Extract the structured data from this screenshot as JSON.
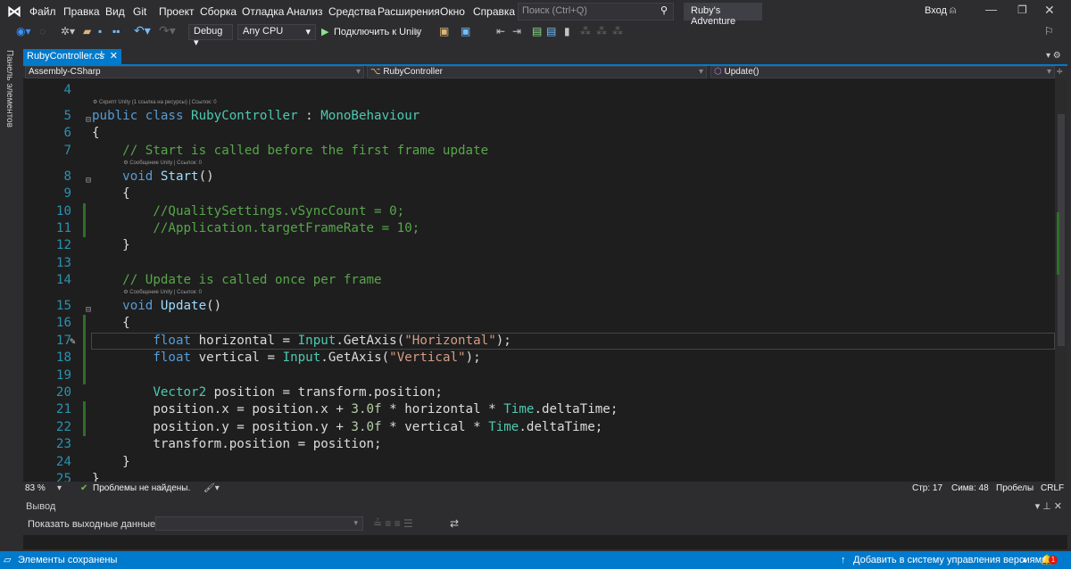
{
  "menu": [
    "Файл",
    "Правка",
    "Вид",
    "Git",
    "Проект",
    "Сборка",
    "Отладка",
    "Анализ",
    "Средства",
    "Расширения",
    "Окно",
    "Справка"
  ],
  "search_placeholder": "Поиск (Ctrl+Q)",
  "project_name": "Ruby's Adventure",
  "login": "Вход",
  "toolbar": {
    "config": "Debug",
    "platform": "Any CPU",
    "attach": "Подключить к Unity"
  },
  "side_panel": "Панель элементов",
  "tab": {
    "title": "RubyController.cs"
  },
  "nav": {
    "project": "Assembly-CSharp",
    "class": "RubyController",
    "member": "Update()"
  },
  "code_lines": [
    {
      "n": "4",
      "t": []
    },
    {
      "lens": "Скрипт Unity (1 ссылка на ресурсы) | Ссылок: 0"
    },
    {
      "n": "5",
      "fold": true,
      "t": [
        [
          "public class ",
          "kw"
        ],
        [
          "RubyController",
          "ty"
        ],
        [
          " : ",
          "pl"
        ],
        [
          "MonoBehaviour",
          "ty"
        ]
      ]
    },
    {
      "n": "6",
      "t": [
        [
          "{",
          "pl"
        ]
      ]
    },
    {
      "n": "7",
      "t": [
        [
          "    // Start is called before the first frame update",
          "cm"
        ]
      ]
    },
    {
      "lens": "Сообщение Unity | Ссылок: 0",
      "indent": 4
    },
    {
      "n": "8",
      "fold": true,
      "t": [
        [
          "    void ",
          "kw"
        ],
        [
          "Start",
          "me"
        ],
        [
          "()",
          "pl"
        ]
      ]
    },
    {
      "n": "9",
      "t": [
        [
          "    {",
          "pl"
        ]
      ]
    },
    {
      "n": "10",
      "chg": true,
      "t": [
        [
          "        //QualitySettings.vSyncCount = 0;",
          "cm"
        ]
      ]
    },
    {
      "n": "11",
      "chg": true,
      "t": [
        [
          "        //Application.targetFrameRate = 10;",
          "cm"
        ]
      ]
    },
    {
      "n": "12",
      "t": [
        [
          "    }",
          "pl"
        ]
      ]
    },
    {
      "n": "13",
      "t": []
    },
    {
      "n": "14",
      "t": [
        [
          "    // Update is called once per frame",
          "cm"
        ]
      ]
    },
    {
      "lens": "Сообщение Unity | Ссылок: 0",
      "indent": 4
    },
    {
      "n": "15",
      "fold": true,
      "t": [
        [
          "    void ",
          "kw"
        ],
        [
          "Update",
          "me"
        ],
        [
          "()",
          "pl"
        ]
      ]
    },
    {
      "n": "16",
      "chg": true,
      "t": [
        [
          "    {",
          "pl"
        ]
      ]
    },
    {
      "n": "17",
      "chg": true,
      "cur": true,
      "t": [
        [
          "        float ",
          "kw"
        ],
        [
          "horizontal = ",
          "pl"
        ],
        [
          "Input",
          "ty"
        ],
        [
          ".GetAxis(",
          "pl"
        ],
        [
          "\"Horizontal\"",
          "st"
        ],
        [
          ");",
          "pl"
        ]
      ]
    },
    {
      "n": "18",
      "chg": true,
      "t": [
        [
          "        float ",
          "kw"
        ],
        [
          "vertical = ",
          "pl"
        ],
        [
          "Input",
          "ty"
        ],
        [
          ".GetAxis(",
          "pl"
        ],
        [
          "\"Vertical\"",
          "st"
        ],
        [
          ");",
          "pl"
        ]
      ]
    },
    {
      "n": "19",
      "chg": true,
      "t": []
    },
    {
      "n": "20",
      "t": [
        [
          "        Vector2",
          "ty"
        ],
        [
          " position = transform.position;",
          "pl"
        ]
      ]
    },
    {
      "n": "21",
      "chg": true,
      "t": [
        [
          "        position.x = position.x + ",
          "pl"
        ],
        [
          "3.0f",
          "nu"
        ],
        [
          " * horizontal * ",
          "pl"
        ],
        [
          "Time",
          "ty"
        ],
        [
          ".deltaTime;",
          "pl"
        ]
      ]
    },
    {
      "n": "22",
      "chg": true,
      "t": [
        [
          "        position.y = position.y + ",
          "pl"
        ],
        [
          "3.0f",
          "nu"
        ],
        [
          " * vertical * ",
          "pl"
        ],
        [
          "Time",
          "ty"
        ],
        [
          ".deltaTime;",
          "pl"
        ]
      ]
    },
    {
      "n": "23",
      "t": [
        [
          "        transform.position = position;",
          "pl"
        ]
      ]
    },
    {
      "n": "24",
      "t": [
        [
          "    }",
          "pl"
        ]
      ]
    },
    {
      "n": "25",
      "t": [
        [
          "}",
          "pl"
        ]
      ]
    }
  ],
  "editor_status": {
    "zoom": "83 %",
    "issues": "Проблемы не найдены.",
    "line": "Стр: 17",
    "col": "Симв: 48",
    "spaces": "Пробелы",
    "eol": "CRLF"
  },
  "output": {
    "title": "Вывод",
    "show_from": "Показать выходные данные из:",
    "source": ""
  },
  "status": {
    "message": "Элементы сохранены",
    "vcs": "Добавить в систему управления версиями",
    "notifications": "1"
  },
  "colors": {
    "accent": "#007acc",
    "editor_bg": "#1e1e1e",
    "keyword": "#569cd6",
    "type": "#4ec9b0",
    "comment": "#57a64a",
    "string": "#d69d85"
  }
}
